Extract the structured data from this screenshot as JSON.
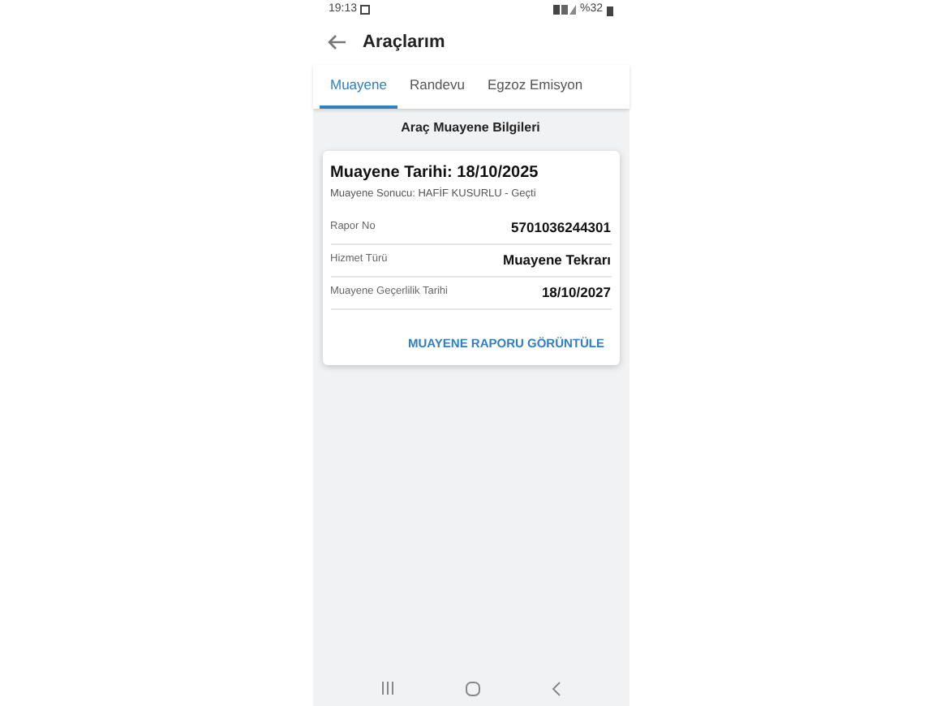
{
  "status_bar": {
    "time": "19:13",
    "battery": "%32"
  },
  "header": {
    "title": "Araçlarım"
  },
  "tabs": [
    {
      "label": "Muayene",
      "selected": true
    },
    {
      "label": "Randevu",
      "selected": false
    },
    {
      "label": "Egzoz Emisyon",
      "selected": false
    }
  ],
  "section_title": "Araç Muayene Bilgileri",
  "card": {
    "title": "Muayene Tarihi: 18/10/2025",
    "subtitle": "Muayene Sonucu: HAFİF KUSURLU - Geçti",
    "rows": [
      {
        "label": "Rapor No",
        "value": "5701036244301"
      },
      {
        "label": "Hizmet Türü",
        "value": "Muayene Tekrarı"
      },
      {
        "label": "Muayene Geçerlilik Tarihi",
        "value": "18/10/2027"
      }
    ],
    "action": "MUAYENE RAPORU GÖRÜNTÜLE"
  }
}
